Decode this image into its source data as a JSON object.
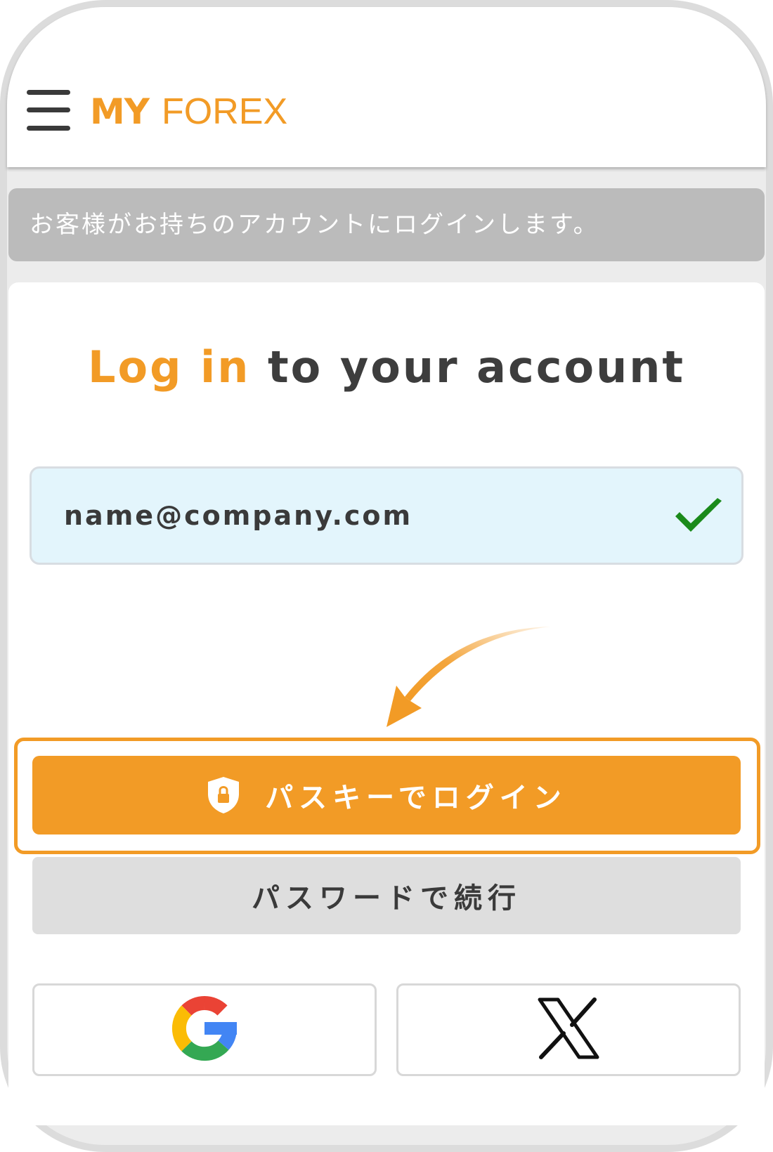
{
  "header": {
    "logo_bold": "MY",
    "logo_light": "FOREX",
    "menu_icon": "hamburger-menu-icon"
  },
  "notice": {
    "text": "お客様がお持ちのアカウントにログインします。"
  },
  "login": {
    "title_accent": "Log in",
    "title_rest": " to your account",
    "email_value": "name@company.com",
    "email_valid_icon": "checkmark-icon",
    "passkey_label": "パスキーでログイン",
    "passkey_icon": "shield-lock-icon",
    "password_label": "パスワードで続行",
    "google_icon": "google-icon",
    "x_icon": "x-logo-icon"
  },
  "colors": {
    "accent": "#f29b26",
    "notice_bg": "#bbbbbb",
    "input_bg": "#e3f5fc",
    "check": "#1a8a1a",
    "secondary_button": "#dedede"
  }
}
